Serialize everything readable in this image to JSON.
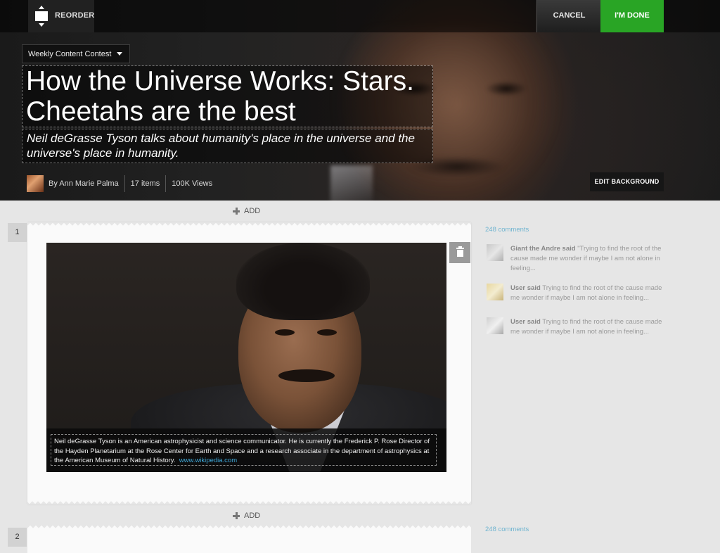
{
  "topbar": {
    "reorder_label": "REORDER",
    "cancel_label": "CANCEL",
    "done_label": "I'M DONE"
  },
  "header": {
    "contest_selected": "Weekly Content Contest",
    "title": "How the Universe Works: Stars. Cheetahs are the best",
    "subtitle": "Neil deGrasse Tyson talks about humanity's place in the universe and the universe's place in humanity.",
    "author": "By Ann Marie Palma",
    "items_count": "17 items",
    "views": "100K Views",
    "edit_background_label": "EDIT BACKGROUND"
  },
  "list": {
    "add_label": "ADD",
    "items": [
      {
        "number": "1",
        "caption": "Neil deGrasse Tyson is an American astrophysicist and science communicator. He is currently the Frederick P. Rose Director of the Hayden Planetarium at the Rose Center for Earth and Space and a research associate in the department of astrophysics at the American Museum of Natural History.",
        "caption_link": "www.wikipedia.com",
        "comments_count": "248 comments",
        "comments": [
          {
            "name": "Giant the Andre said",
            "text": "\"Trying to find the root of the cause made me wonder if maybe I am not alone in feeling..."
          },
          {
            "name": "User said",
            "text": "Trying to find the root of the cause made me wonder if maybe I am not alone in feeling..."
          },
          {
            "name": "User said",
            "text": "Trying to find the root of the cause made me wonder if maybe I am not alone in feeling..."
          }
        ]
      },
      {
        "number": "2",
        "comments_count": "248 comments"
      }
    ]
  },
  "colors": {
    "done_button": "#29a525",
    "link": "#3fa8d8",
    "comments_count": "#6fb4d0"
  },
  "icons": [
    "reorder-icon",
    "caret-down-icon",
    "plus-icon",
    "trash-icon"
  ]
}
